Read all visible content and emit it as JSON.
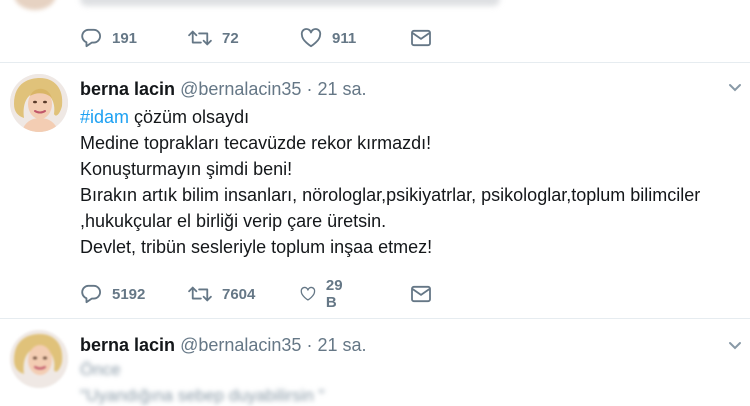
{
  "top_tweet": {
    "replies": "191",
    "retweets": "72",
    "likes": "911"
  },
  "main_tweet": {
    "display_name": "berna lacin",
    "handle": "@bernalacin35",
    "separator": "·",
    "time": "21 sa.",
    "hashtag": "#idam",
    "line1_rest": " çözüm olsaydı",
    "lines": [
      "Medine toprakları tecavüzde rekor kırmazdı!",
      "Konuşturmayın şimdi beni!",
      "Bırakın artık bilim insanları, nörologlar,psikiyatrlar, psikologlar,toplum bilimciler",
      ",hukukçular el birliği verip çare üretsin.",
      "Devlet, tribün sesleriyle toplum inşaa etmez!"
    ],
    "replies": "5192",
    "retweets": "7604",
    "likes": "29 B"
  },
  "next_tweet": {
    "display_name": "berna lacin",
    "handle": "@bernalacin35",
    "separator": "·",
    "time": "21 sa.",
    "first_word": "Önce",
    "second_line": "\"Uyandığına sebep duyabilirsin \""
  },
  "icons": [
    "reply-icon",
    "retweet-icon",
    "like-icon",
    "direct-message-icon",
    "chevron-down-icon"
  ],
  "colors": {
    "hashtag": "#1da1f2",
    "text": "#14171a",
    "muted": "#657786",
    "divider": "#e6ecf0"
  }
}
